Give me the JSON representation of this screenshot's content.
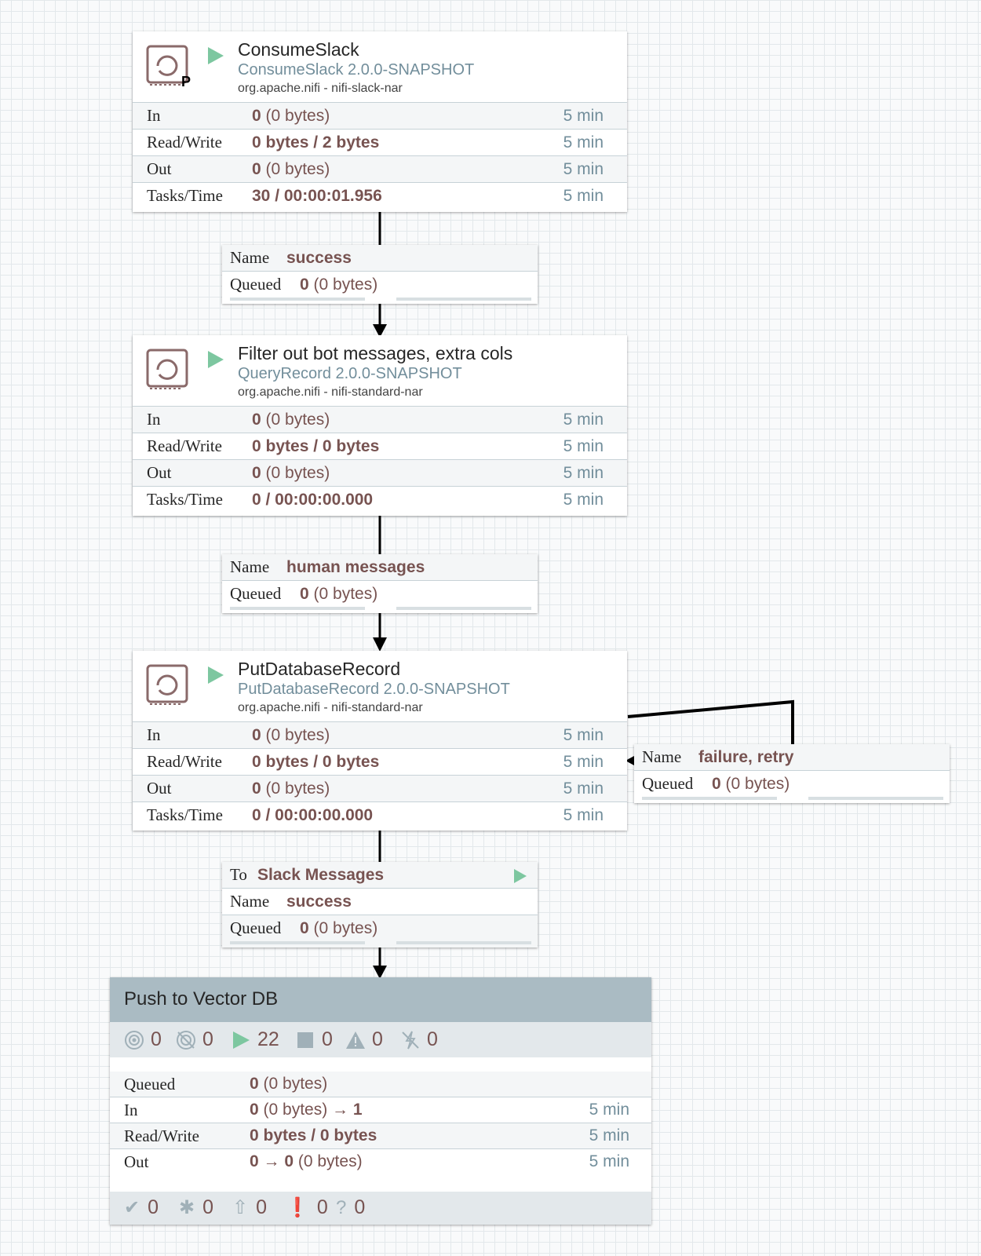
{
  "processors": [
    {
      "name": "ConsumeSlack",
      "type": "ConsumeSlack 2.0.0-SNAPSHOT",
      "bundle": "org.apache.nifi - nifi-slack-nar",
      "badge": "P",
      "stats": [
        {
          "label": "In",
          "value_bold": "0",
          "value_rest": " (0 bytes)",
          "time": "5 min"
        },
        {
          "label": "Read/Write",
          "value_bold": "0 bytes / 2 bytes",
          "value_rest": "",
          "time": "5 min"
        },
        {
          "label": "Out",
          "value_bold": "0",
          "value_rest": " (0 bytes)",
          "time": "5 min"
        },
        {
          "label": "Tasks/Time",
          "value_bold": "30 / 00:00:01.956",
          "value_rest": "",
          "time": "5 min"
        }
      ]
    },
    {
      "name": "Filter out bot messages, extra cols",
      "type": "QueryRecord 2.0.0-SNAPSHOT",
      "bundle": "org.apache.nifi - nifi-standard-nar",
      "stats": [
        {
          "label": "In",
          "value_bold": "0",
          "value_rest": " (0 bytes)",
          "time": "5 min"
        },
        {
          "label": "Read/Write",
          "value_bold": "0 bytes / 0 bytes",
          "value_rest": "",
          "time": "5 min"
        },
        {
          "label": "Out",
          "value_bold": "0",
          "value_rest": " (0 bytes)",
          "time": "5 min"
        },
        {
          "label": "Tasks/Time",
          "value_bold": "0 / 00:00:00.000",
          "value_rest": "",
          "time": "5 min"
        }
      ]
    },
    {
      "name": "PutDatabaseRecord",
      "type": "PutDatabaseRecord 2.0.0-SNAPSHOT",
      "bundle": "org.apache.nifi - nifi-standard-nar",
      "stats": [
        {
          "label": "In",
          "value_bold": "0",
          "value_rest": " (0 bytes)",
          "time": "5 min"
        },
        {
          "label": "Read/Write",
          "value_bold": "0 bytes / 0 bytes",
          "value_rest": "",
          "time": "5 min"
        },
        {
          "label": "Out",
          "value_bold": "0",
          "value_rest": " (0 bytes)",
          "time": "5 min"
        },
        {
          "label": "Tasks/Time",
          "value_bold": "0 / 00:00:00.000",
          "value_rest": "",
          "time": "5 min"
        }
      ]
    }
  ],
  "connections": [
    {
      "name_label": "Name",
      "name": "success",
      "queued_label": "Queued",
      "queued_bold": "0",
      "queued_rest": " (0 bytes)"
    },
    {
      "name_label": "Name",
      "name": "human messages",
      "queued_label": "Queued",
      "queued_bold": "0",
      "queued_rest": " (0 bytes)"
    },
    {
      "name_label": "Name",
      "name": "failure, retry",
      "queued_label": "Queued",
      "queued_bold": "0",
      "queued_rest": " (0 bytes)"
    },
    {
      "to_label": "To",
      "to": "Slack Messages",
      "name_label": "Name",
      "name": "success",
      "queued_label": "Queued",
      "queued_bold": "0",
      "queued_rest": " (0 bytes)"
    }
  ],
  "process_group": {
    "title": "Push to Vector DB",
    "status": {
      "transmitting": "0",
      "not_transmitting": "0",
      "running": "22",
      "stopped": "0",
      "invalid": "0",
      "disabled": "0"
    },
    "stats": {
      "queued_label": "Queued",
      "queued_bold": "0",
      "queued_rest": " (0 bytes)",
      "in_label": "In",
      "in_bold": "0",
      "in_rest": " (0 bytes) → ",
      "in_ports": "1",
      "in_time": "5 min",
      "rw_label": "Read/Write",
      "rw_bold": "0 bytes / 0 bytes",
      "rw_time": "5 min",
      "out_label": "Out",
      "out_bold": "0 → 0",
      "out_rest": " (0 bytes)",
      "out_time": "5 min"
    },
    "versions": {
      "up_to_date": "0",
      "locally_modified": "0",
      "stale": "0",
      "modified_stale": "0",
      "sync_failure": "0"
    }
  },
  "colors": {
    "running_green": "#7dc7a0",
    "value_brown": "#775351",
    "type_blue": "#728e9b",
    "pg_header": "#aabbc3"
  }
}
